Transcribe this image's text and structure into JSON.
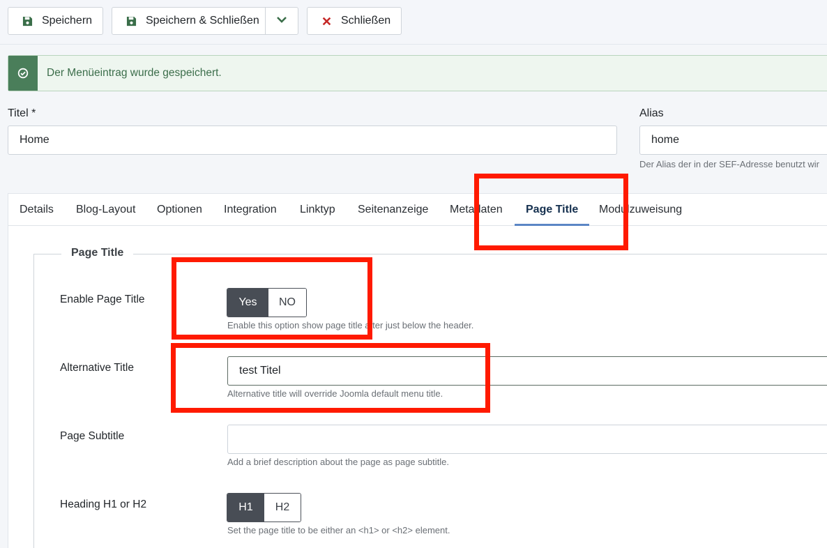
{
  "toolbar": {
    "save_label": "Speichern",
    "save_close_label": "Speichern & Schließen",
    "close_label": "Schließen"
  },
  "alert": {
    "message": "Der Menüeintrag wurde gespeichert."
  },
  "title_field": {
    "label": "Titel *",
    "value": "Home"
  },
  "alias_field": {
    "label": "Alias",
    "value": "home",
    "hint": "Der Alias der in der SEF-Adresse benutzt wir"
  },
  "tabs": [
    {
      "label": "Details"
    },
    {
      "label": "Blog-Layout"
    },
    {
      "label": "Optionen"
    },
    {
      "label": "Integration"
    },
    {
      "label": "Linktyp"
    },
    {
      "label": "Seitenanzeige"
    },
    {
      "label": "Metadaten"
    },
    {
      "label": "Page Title",
      "active": true
    },
    {
      "label": "Modulzuweisung"
    }
  ],
  "fieldset": {
    "legend": "Page Title",
    "enable_page_title": {
      "label": "Enable Page Title",
      "yes": "Yes",
      "no": "NO",
      "selected": "Yes",
      "hint": "Enable this option show page title after just below the header."
    },
    "alternative_title": {
      "label": "Alternative Title",
      "value": "test Titel",
      "hint": "Alternative title will override Joomla default menu title."
    },
    "page_subtitle": {
      "label": "Page Subtitle",
      "value": "",
      "hint": "Add a brief description about the page as page subtitle."
    },
    "heading": {
      "label": "Heading H1 or H2",
      "h1": "H1",
      "h2": "H2",
      "selected": "H1",
      "hint": "Set the page title to be either an <h1> or <h2> element."
    }
  },
  "colors": {
    "highlight": "#ff1a00",
    "success_accent": "#4a7e5a",
    "toggle_on": "#484d55",
    "active_tab_underline": "#5b86c5",
    "close_icon": "#c52827"
  }
}
